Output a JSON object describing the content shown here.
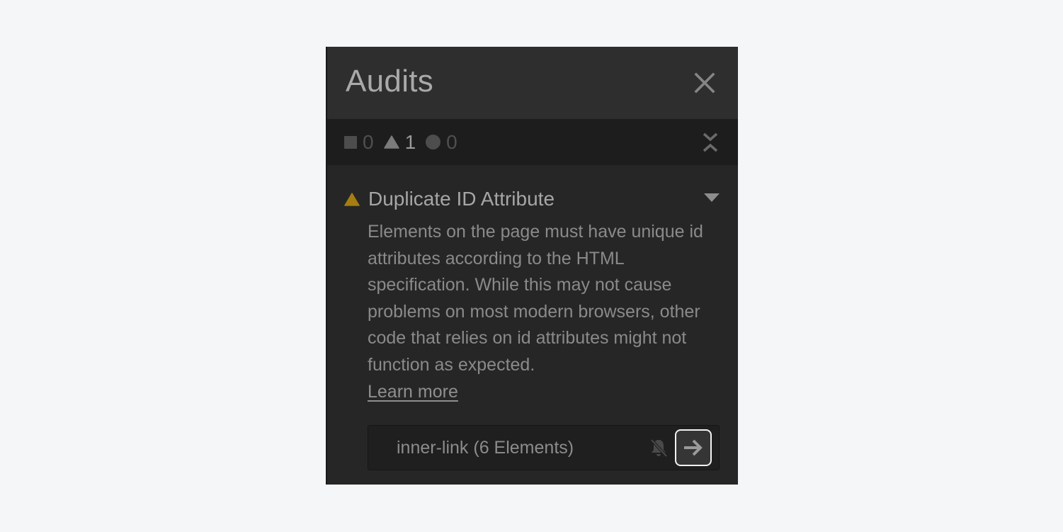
{
  "panel": {
    "title": "Audits",
    "close_icon": "close-icon"
  },
  "summary": {
    "errors": {
      "icon": "square-icon",
      "count": "0"
    },
    "warnings": {
      "icon": "triangle-icon",
      "count": "1"
    },
    "suggestions": {
      "icon": "circle-icon",
      "count": "0"
    },
    "collapse_icon": "collapse-all-icon"
  },
  "issue": {
    "severity": "warning",
    "severity_color": "#a57d10",
    "title": "Duplicate ID Attribute",
    "description": "Elements on the page must have unique id attributes according to the HTML specification. While this may not cause problems on most modern browsers, other code that relies on id attributes might not function as expected.",
    "learn_more_label": "Learn more",
    "elements": [
      {
        "label": "inner-link (6 Elements)",
        "mute_icon": "bell-off-icon",
        "go_icon": "arrow-right-icon"
      }
    ]
  },
  "colors": {
    "panel_bg": "#262626",
    "header_bg": "#2e2e2e",
    "summary_bg": "#1d1d1d",
    "page_bg": "#f5f6f8",
    "warning": "#a57d10"
  }
}
